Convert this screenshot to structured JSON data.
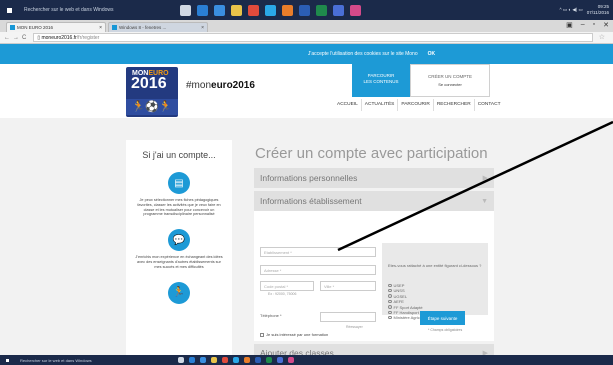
{
  "taskbar": {
    "search_placeholder": "Rechercher sur le web et dans Windows",
    "clock_time": "09:25",
    "clock_date": "07/11/2016",
    "apps": [
      {
        "name": "task-view-icon",
        "color": "#d0d8e4"
      },
      {
        "name": "edge-icon",
        "color": "#2a7fd4"
      },
      {
        "name": "store-icon",
        "color": "#3a8fe0"
      },
      {
        "name": "explorer-icon",
        "color": "#e8c34a"
      },
      {
        "name": "chrome-icon",
        "color": "#e04b3c"
      },
      {
        "name": "skype-icon",
        "color": "#2aa8e8"
      },
      {
        "name": "firefox-icon",
        "color": "#e87d2a"
      },
      {
        "name": "word-icon",
        "color": "#2b5eb5"
      },
      {
        "name": "excel-icon",
        "color": "#1f8a4c"
      },
      {
        "name": "teams-icon",
        "color": "#4a6fd6"
      },
      {
        "name": "photos-icon",
        "color": "#d44a8a"
      }
    ]
  },
  "browser": {
    "tab1": "MON EURO 2016",
    "tab2": "Windows 8 - fenetres ...",
    "url_domain": "moneuro2016.fr",
    "url_path": "/fr/register"
  },
  "cookie": {
    "text": "J'accepte l'utilisation des cookies sur le site Mono",
    "ok": "OK"
  },
  "header": {
    "logo_mon": "MON",
    "logo_euro": "EURO",
    "logo_year": "2016",
    "hashtag_prefix": "#mon",
    "hashtag_bold": "euro2016",
    "parcourir_line1": "PARCOURIR",
    "parcourir_line2": "LES CONTENUS",
    "account_label": "CRÉER UN COMPTE",
    "account_login": "Se connecter"
  },
  "nav": [
    "ACCUEIL",
    "ACTUALITÉS",
    "PARCOURIR",
    "RECHERCHER",
    "CONTACT"
  ],
  "sidebar": {
    "title": "Si j'ai un compte...",
    "block1": "Je peux sélectionner mes fiches pédagogiques favorites, classer les activités que je veux faire en classe et les mutualiser pour concevoir un programme transdisciplinaire personnalisé",
    "block2": "J'enrichis mon expérience en échangeant des idées avec des enseignants d'autres établissements sur mes succès et mes difficultés"
  },
  "main": {
    "title": "Créer un compte avec participation",
    "acc_personal": "Informations personnelles",
    "acc_etab": "Informations établissement",
    "acc_classes": "Ajouter des classes",
    "ph_etab": "Etablissement *",
    "ph_adresse": "Adresse *",
    "ph_cp": "Code postal *",
    "ph_ville": "Ville *",
    "hint_cp": "Ex : 92000, 75006",
    "label_tel": "Téléphone *",
    "hint_tel": "Réessayer",
    "chk_formation": "Je suis intéressé par une formation",
    "chk_saison": "J'ai participé à la saison précédente",
    "question": "Etes-vous rattaché à une entité figurant ci-dessous ?",
    "options": [
      "USEP",
      "UNSS",
      "UGSEL",
      "AEFE",
      "FF Sport Adapté",
      "FF Handisport",
      "Ministère Agriculture"
    ],
    "next": "Étape suivante",
    "required_note": "* Champs obligatoires"
  }
}
